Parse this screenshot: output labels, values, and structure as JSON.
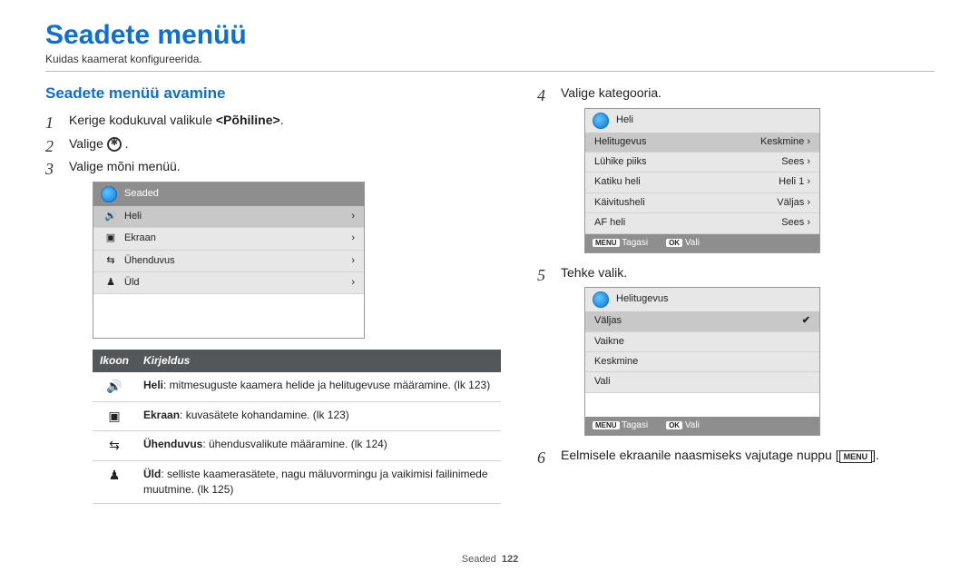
{
  "title": "Seadete menüü",
  "subtitle": "Kuidas kaamerat konfigureerida.",
  "left": {
    "heading": "Seadete menüü avamine",
    "step1_a": "Kerige kodukuval valikule ",
    "step1_b": "<Põhiline>",
    "step1_c": ".",
    "step2_a": "Valige ",
    "step2_b": ".",
    "step3": "Valige mõni menüü.",
    "mock_header": "Seaded",
    "mock_rows": {
      "r0": {
        "icon": "🔊",
        "label": "Heli"
      },
      "r1": {
        "icon": "▣",
        "label": "Ekraan"
      },
      "r2": {
        "icon": "⇆",
        "label": "Ühenduvus"
      },
      "r3": {
        "icon": "♟",
        "label": "Üld"
      }
    },
    "table": {
      "th_icon": "Ikoon",
      "th_desc": "Kirjeldus",
      "rows": {
        "r0": {
          "icon": "🔊",
          "b": "Heli",
          "t": ": mitmesuguste kaamera helide ja helitugevuse määramine. (lk 123)"
        },
        "r1": {
          "icon": "▣",
          "b": "Ekraan",
          "t": ": kuvasätete kohandamine. (lk 123)"
        },
        "r2": {
          "icon": "⇆",
          "b": "Ühenduvus",
          "t": ": ühendusvalikute määramine. (lk 124)"
        },
        "r3": {
          "icon": "♟",
          "b": "Üld",
          "t": ": selliste kaamerasätete, nagu mäluvormingu ja vaikimisi failinimede muutmine. (lk 125)"
        }
      }
    }
  },
  "right": {
    "step4": "Valige kategooria.",
    "cat_header": "Heli",
    "cat_rows": {
      "r0": {
        "label": "Helitugevus",
        "value": "Keskmine"
      },
      "r1": {
        "label": "Lühike piiks",
        "value": "Sees"
      },
      "r2": {
        "label": "Katiku heli",
        "value": "Heli 1"
      },
      "r3": {
        "label": "Käivitusheli",
        "value": "Väljas"
      },
      "r4": {
        "label": "AF heli",
        "value": "Sees"
      }
    },
    "footer_back_chip": "MENU",
    "footer_back": "Tagasi",
    "footer_ok_chip": "OK",
    "footer_ok": "Vali",
    "step5": "Tehke valik.",
    "vol_header": "Helitugevus",
    "vol_rows": {
      "r0": "Väljas",
      "r1": "Vaikne",
      "r2": "Keskmine",
      "r3": "Vali"
    },
    "step6_a": "Eelmisele ekraanile naasmiseks vajutage nuppu [",
    "step6_b": "].",
    "menu_word": "MENU"
  },
  "footer_label": "Seaded",
  "footer_page": "122"
}
